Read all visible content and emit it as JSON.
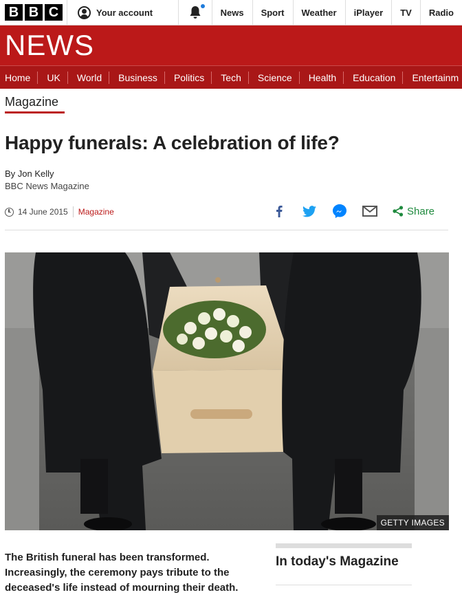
{
  "brand": {
    "letters": [
      "B",
      "B",
      "C"
    ],
    "news_wordmark": "NEWS",
    "color_red": "#bb1919"
  },
  "topbar": {
    "account_label": "Your account",
    "nav": [
      "News",
      "Sport",
      "Weather",
      "iPlayer",
      "TV",
      "Radio"
    ]
  },
  "mainnav": [
    "Home",
    "UK",
    "World",
    "Business",
    "Politics",
    "Tech",
    "Science",
    "Health",
    "Education",
    "Entertainm"
  ],
  "section": "Magazine",
  "article": {
    "headline": "Happy funerals: A celebration of life?",
    "author": "By Jon Kelly",
    "author_role": "BBC News Magazine",
    "date": "14 June 2015",
    "tag": "Magazine",
    "share_label": "Share",
    "image_caption": "GETTY IMAGES",
    "summary": "The British funeral has been transformed. Increasingly, the ceremony pays tribute to the deceased's life instead of mourning their death."
  },
  "sidebar": {
    "heading": "In today's Magazine"
  },
  "icons": [
    "user-icon",
    "bell-icon",
    "facebook-icon",
    "twitter-icon",
    "messenger-icon",
    "email-icon",
    "share-icon",
    "clock-icon"
  ]
}
